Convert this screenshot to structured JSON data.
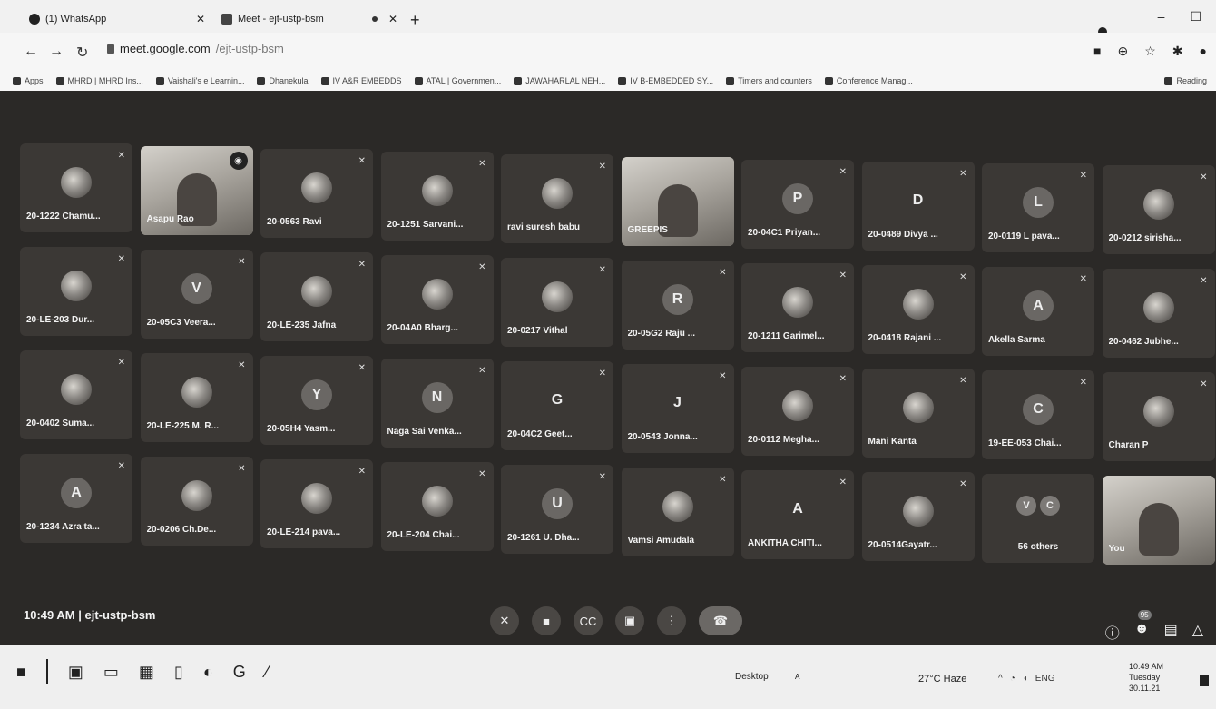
{
  "browser": {
    "tabs": [
      {
        "label": "(1) WhatsApp",
        "icon": "whatsapp-icon"
      },
      {
        "label": "Meet - ejt-ustp-bsm",
        "icon": "meet-icon"
      }
    ],
    "new_tab": "+",
    "url_host": "meet.google.com",
    "url_path": "/ejt-ustp-bsm",
    "bookmarks": [
      "Apps",
      "MHRD | MHRD Ins...",
      "Vaishali's e Learnin...",
      "Dhanekula",
      "IV A&R EMBEDDS",
      "ATAL | Governmen...",
      "JAWAHARLAL NEH...",
      "IV B-EMBEDDED SY...",
      "Timers and counters",
      "Conference Manag..."
    ],
    "reading_list": "Reading"
  },
  "meet": {
    "tiles": [
      {
        "name": "20-1222 Chamu...",
        "avatar": "",
        "kind": "photo"
      },
      {
        "name": "Asapu Rao",
        "avatar": "",
        "kind": "video-speaking"
      },
      {
        "name": "20-0563 Ravi",
        "avatar": "",
        "kind": "photo"
      },
      {
        "name": "20-1251 Sarvani...",
        "avatar": "",
        "kind": "photo"
      },
      {
        "name": "ravi suresh babu",
        "avatar": "",
        "kind": "photo"
      },
      {
        "name": "GREEPIS",
        "avatar": "",
        "kind": "video"
      },
      {
        "name": "20-04C1 Priyan...",
        "avatar": "P",
        "kind": "letter"
      },
      {
        "name": "20-0489 Divya ...",
        "avatar": "D",
        "kind": "plain"
      },
      {
        "name": "20-0119 L pava...",
        "avatar": "L",
        "kind": "letter"
      },
      {
        "name": "20-0212 sirisha...",
        "avatar": "",
        "kind": "photo"
      },
      {
        "name": "20-LE-203 Dur...",
        "avatar": "",
        "kind": "photo"
      },
      {
        "name": "20-05C3 Veera...",
        "avatar": "V",
        "kind": "letter"
      },
      {
        "name": "20-LE-235 Jafna",
        "avatar": "",
        "kind": "photo"
      },
      {
        "name": "20-04A0 Bharg...",
        "avatar": "",
        "kind": "photo"
      },
      {
        "name": "20-0217 Vithal",
        "avatar": "",
        "kind": "photo"
      },
      {
        "name": "20-05G2 Raju ...",
        "avatar": "R",
        "kind": "letter"
      },
      {
        "name": "20-1211 Garimel...",
        "avatar": "",
        "kind": "photo"
      },
      {
        "name": "20-0418 Rajani ...",
        "avatar": "",
        "kind": "photo"
      },
      {
        "name": "Akella Sarma",
        "avatar": "A",
        "kind": "letter"
      },
      {
        "name": "20-0462 Jubhe...",
        "avatar": "",
        "kind": "photo"
      },
      {
        "name": "20-0402 Suma...",
        "avatar": "",
        "kind": "photo"
      },
      {
        "name": "20-LE-225 M. R...",
        "avatar": "",
        "kind": "photo"
      },
      {
        "name": "20-05H4 Yasm...",
        "avatar": "Y",
        "kind": "letter"
      },
      {
        "name": "Naga Sai Venka...",
        "avatar": "N",
        "kind": "letter"
      },
      {
        "name": "20-04C2 Geet...",
        "avatar": "G",
        "kind": "plain"
      },
      {
        "name": "20-0543 Jonna...",
        "avatar": "J",
        "kind": "plain"
      },
      {
        "name": "20-0112 Megha...",
        "avatar": "",
        "kind": "photo"
      },
      {
        "name": "Mani Kanta",
        "avatar": "",
        "kind": "photo"
      },
      {
        "name": "19-EE-053 Chai...",
        "avatar": "C",
        "kind": "letter"
      },
      {
        "name": "Charan P",
        "avatar": "",
        "kind": "photo"
      },
      {
        "name": "20-1234 Azra ta...",
        "avatar": "A",
        "kind": "letter"
      },
      {
        "name": "20-0206 Ch.De...",
        "avatar": "",
        "kind": "photo"
      },
      {
        "name": "20-LE-214 pava...",
        "avatar": "",
        "kind": "photo"
      },
      {
        "name": "20-LE-204 Chai...",
        "avatar": "",
        "kind": "photo"
      },
      {
        "name": "20-1261 U. Dha...",
        "avatar": "U",
        "kind": "letter"
      },
      {
        "name": "Vamsi Amudala",
        "avatar": "",
        "kind": "photo"
      },
      {
        "name": "ANKITHA CHITI...",
        "avatar": "A",
        "kind": "plain"
      },
      {
        "name": "20-0514Gayatr...",
        "avatar": "",
        "kind": "photo"
      },
      {
        "name": "56 others",
        "avatar": "V C",
        "kind": "others"
      },
      {
        "name": "You",
        "avatar": "",
        "kind": "video-self"
      }
    ],
    "meeting_time": "10:49 AM",
    "meeting_code": "ejt-ustp-bsm",
    "participants_badge": "95"
  },
  "taskbar": {
    "desktop_label": "Desktop",
    "weather": "27°C Haze",
    "lang": "ENG",
    "time": "10:49 AM",
    "day": "Tuesday",
    "date": "30.11.21"
  }
}
